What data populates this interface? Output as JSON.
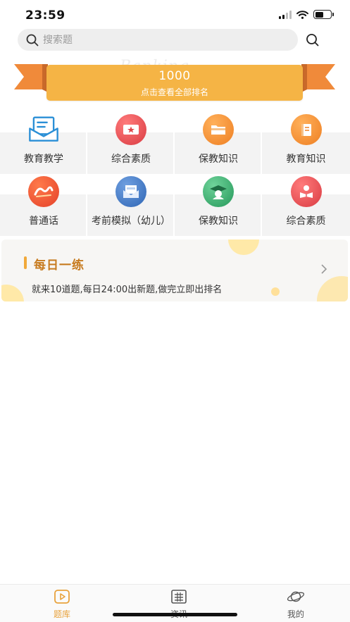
{
  "status": {
    "time": "23:59"
  },
  "search": {
    "placeholder": "搜索题"
  },
  "banner": {
    "watermark": "Banking",
    "score": "1000",
    "subtitle": "点击查看全部排名"
  },
  "categories": [
    {
      "label": "教育教学",
      "icon": "envelope-icon",
      "color": "#2a8fd6"
    },
    {
      "label": "综合素质",
      "icon": "ticket-star-icon",
      "color": "#e0454a"
    },
    {
      "label": "保教知识",
      "icon": "folder-icon",
      "color": "#f08a2a"
    },
    {
      "label": "教育知识",
      "icon": "book-icon",
      "color": "#f08a2a"
    },
    {
      "label": "普通话",
      "icon": "mandarin-logo-icon",
      "color": "#e8472e"
    },
    {
      "label": "考前模拟（幼儿）",
      "icon": "offer-mail-icon",
      "color": "#3a74c0"
    },
    {
      "label": "保教知识",
      "icon": "graduate-icon",
      "color": "#2faa6a"
    },
    {
      "label": "综合素质",
      "icon": "reader-icon",
      "color": "#e0404a"
    }
  ],
  "daily": {
    "title": "每日一练",
    "description": "就来10道题,每日24:00出新题,做完立即出排名"
  },
  "tabs": [
    {
      "label": "题库",
      "icon": "video-play-icon",
      "active": true
    },
    {
      "label": "资讯",
      "icon": "news-icon",
      "active": false
    },
    {
      "label": "我的",
      "icon": "planet-icon",
      "active": false
    }
  ],
  "colors": {
    "accent": "#e8a23c",
    "banner": "#f5b445",
    "ribbon": "#f08a3a"
  }
}
